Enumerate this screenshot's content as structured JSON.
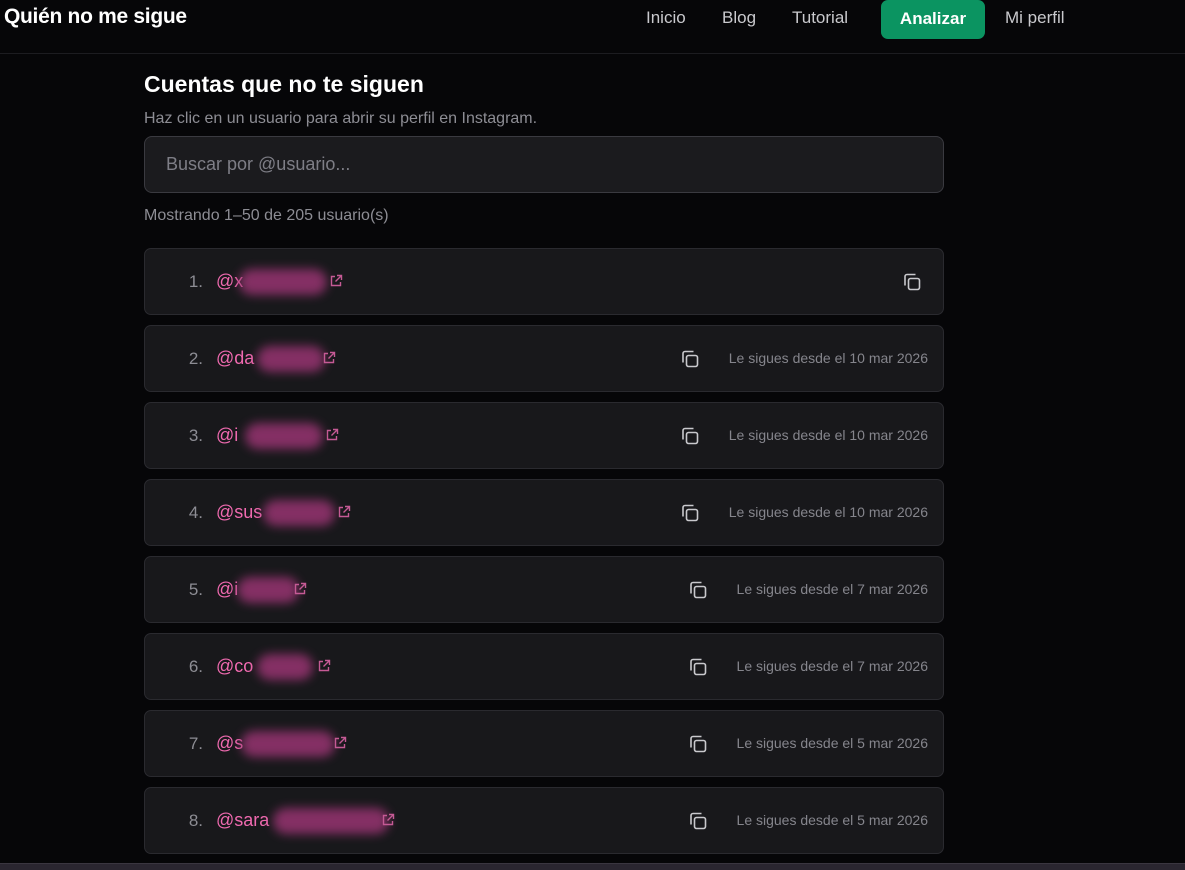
{
  "app": {
    "brand": "Quién no me sigue"
  },
  "nav": {
    "items": [
      "Inicio",
      "Blog",
      "Tutorial"
    ],
    "cta": "Analizar",
    "profile": "Mi perfil",
    "cta_color": "#0b9461"
  },
  "main": {
    "title": "Cuentas que no te siguen",
    "subtitle": "Haz clic en un usuario para abrir su perfil en Instagram.",
    "search_placeholder": "Buscar por @usuario...",
    "count_text": "Mostrando 1–50 de 205 usuario(s)"
  },
  "rows": [
    {
      "num": "1.",
      "handle_visible": "@x",
      "since": ""
    },
    {
      "num": "2.",
      "handle_visible": "@da",
      "since": "Le sigues desde el 10 mar 2026"
    },
    {
      "num": "3.",
      "handle_visible": "@i",
      "since": "Le sigues desde el 10 mar 2026"
    },
    {
      "num": "4.",
      "handle_visible": "@sus",
      "since": "Le sigues desde el 10 mar 2026"
    },
    {
      "num": "5.",
      "handle_visible": "@i",
      "since": "Le sigues desde el 7 mar 2026"
    },
    {
      "num": "6.",
      "handle_visible": "@co",
      "since": "Le sigues desde el 7 mar 2026"
    },
    {
      "num": "7.",
      "handle_visible": "@s",
      "since": "Le sigues desde el 5 mar 2026"
    },
    {
      "num": "8.",
      "handle_visible": "@sara",
      "since": "Le sigues desde el 5 mar 2026"
    }
  ],
  "icons": {
    "external": "external-link-icon",
    "copy": "copy-icon"
  },
  "colors": {
    "handle": "#f06ab0",
    "background": "#060608",
    "card": "#18181b"
  }
}
